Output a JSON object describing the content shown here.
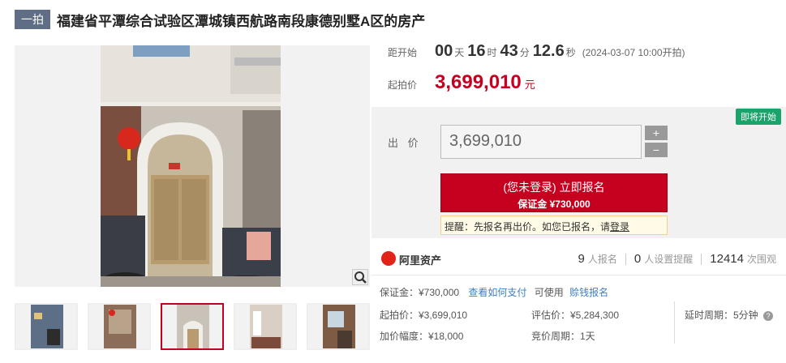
{
  "header": {
    "tag": "一拍",
    "title": "福建省平潭综合试验区潭城镇西航路南段康德别墅A区的房产"
  },
  "countdown": {
    "label": "距开始",
    "days": "00",
    "days_unit": "天",
    "hours": "16",
    "hours_unit": "时",
    "minutes": "43",
    "minutes_unit": "分",
    "seconds": "12.6",
    "seconds_unit": "秒",
    "start_note": "(2024-03-07 10:00开拍)"
  },
  "start_price": {
    "label": "起拍价",
    "value": "3,699,010",
    "unit": "元"
  },
  "bid": {
    "status_badge": "即将开始",
    "label": "出 价",
    "input_value": "3,699,010",
    "plus": "+",
    "minus": "−",
    "signup_line1": "(您未登录) 立即报名",
    "signup_line2": "保证金 ¥730,000",
    "notice_prefix": "提醒：先报名再出价。如您已报名，请",
    "notice_link": "登录"
  },
  "brand": {
    "name": "阿里资产",
    "signups_count": "9",
    "signups_label": "人报名",
    "reminders_count": "0",
    "reminders_label": "人设置提醒",
    "views_count": "12414",
    "views_label": "次围观"
  },
  "details": {
    "deposit": "保证金：¥730,000",
    "how_to_pay": "查看如何支付",
    "usable": "可使用",
    "fast_signup": "赊钱报名",
    "start_price": "起拍价：¥3,699,010",
    "appraisal": "评估价：¥5,284,300",
    "delay": "延时周期：5分钟",
    "increment": "加价幅度：¥18,000",
    "bid_cycle": "竞价周期：1天"
  },
  "colors": {
    "accent": "#c6001f",
    "badge": "#1aa36b",
    "tag": "#5f6e85",
    "link": "#3d7fc1"
  },
  "icons": {
    "zoom": "magnifier-icon",
    "help": "question-icon",
    "logo": "alibaba-logo-icon"
  }
}
